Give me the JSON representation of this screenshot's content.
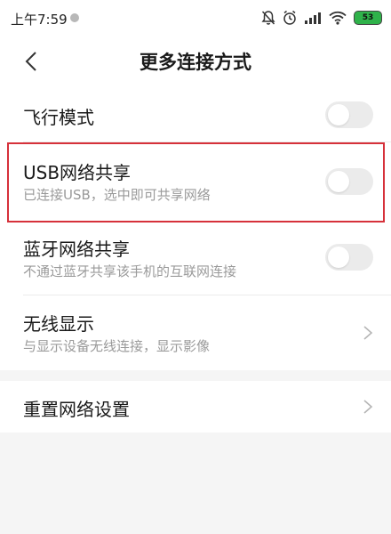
{
  "status_bar": {
    "time": "上午7:59",
    "battery": "53",
    "icons": [
      "bell-muted-icon",
      "alarm-icon",
      "signal-icon",
      "wifi-icon",
      "battery-icon"
    ]
  },
  "header": {
    "title": "更多连接方式",
    "back_icon": "back-arrow-icon"
  },
  "settings": [
    {
      "title": "飞行模式",
      "subtitle": "",
      "control": "toggle",
      "on": false
    },
    {
      "title": "USB网络共享",
      "subtitle": "已连接USB，选中即可共享网络",
      "control": "toggle",
      "on": false,
      "highlighted": true
    },
    {
      "title": "蓝牙网络共享",
      "subtitle": "不通过蓝牙共享该手机的互联网连接",
      "control": "toggle",
      "on": false
    },
    {
      "title": "无线显示",
      "subtitle": "与显示设备无线连接，显示影像",
      "control": "chevron"
    }
  ],
  "reset": {
    "title": "重置网络设置",
    "control": "chevron"
  },
  "colors": {
    "highlight_border": "#d6313a",
    "battery_fill": "#2fb24a",
    "toggle_off": "#ebebeb",
    "background": "#f5f5f5"
  }
}
